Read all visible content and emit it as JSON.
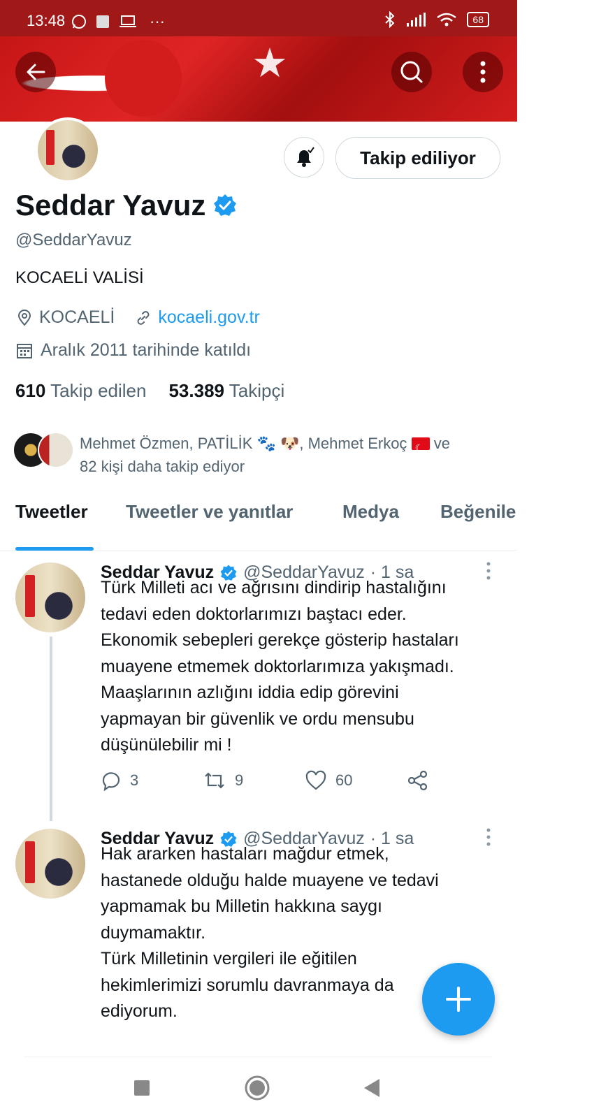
{
  "status": {
    "time": "13:48",
    "battery": "68",
    "more": "···"
  },
  "colors": {
    "accent": "#1d9bf0",
    "status_bar": "#a01818",
    "banner": "#d31c1c"
  },
  "header": {
    "back_icon": "arrow-left-icon",
    "search_icon": "search-icon",
    "more_icon": "more-vertical-icon"
  },
  "profile": {
    "follow_label": "Takip ediliyor",
    "name": "Seddar Yavuz",
    "handle": "@SeddarYavuz",
    "bio": "KOCAELİ VALİSİ",
    "location": "KOCAELİ",
    "website": "kocaeli.gov.tr",
    "joined": "Aralık 2011 tarihinde katıldı",
    "following_count": "610",
    "following_label": "Takip edilen",
    "followers_count": "53.389",
    "followers_label": "Takipçi",
    "known_a": "Mehmet Özmen, PATİLİK 🐾 🐶, Mehmet Erkoç",
    "known_b": "ve",
    "known_c": "82 kişi daha takip ediyor"
  },
  "tabs": [
    "Tweetler",
    "Tweetler ve yanıtlar",
    "Medya",
    "Beğenile"
  ],
  "tweets": [
    {
      "name": "Seddar Yavuz",
      "handle": "@SeddarYavuz",
      "time": "· 1 sa",
      "text": "Türk Milleti acı ve ağrısını dindirip hastalığını\ntedavi eden doktorlarımızı baştacı eder.\nEkonomik sebepleri gerekçe gösterip hastaları\nmuayene etmemek doktorlarımıza yakışmadı.\nMaaşlarının azlığını iddia edip görevini\nyapmayan bir güvenlik ve ordu mensubu\ndüşünülebilir mi !",
      "replies": "3",
      "retweets": "9",
      "likes": "60"
    },
    {
      "name": "Seddar Yavuz",
      "handle": "@SeddarYavuz",
      "time": "· 1 sa",
      "text": "Hak ararken hastaları mağdur etmek,\nhastanede olduğu halde muayene ve tedavi\nyapmamak bu Milletin hakkına saygı\nduymamaktır.\nTürk Milletinin vergileri ile eğitilen\nhekimlerimizi sorumlu davranmaya da\nediyorum."
    }
  ]
}
